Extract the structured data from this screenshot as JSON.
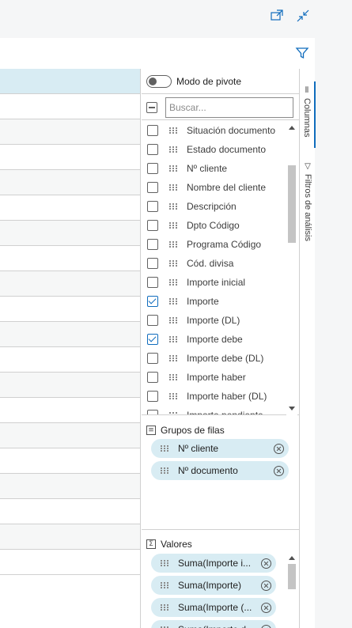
{
  "toolbar": {
    "icons": [
      "open-in-new-window-icon",
      "collapse-icon",
      "filter-icon"
    ]
  },
  "tool_panel": {
    "pivot_mode_label": "Modo de pivote",
    "search_placeholder": "Buscar...",
    "columns": [
      {
        "label": "Situación documento",
        "checked": false
      },
      {
        "label": "Estado documento",
        "checked": false
      },
      {
        "label": "Nº cliente",
        "checked": false
      },
      {
        "label": "Nombre del cliente",
        "checked": false
      },
      {
        "label": "Descripción",
        "checked": false
      },
      {
        "label": "Dpto Código",
        "checked": false
      },
      {
        "label": "Programa Código",
        "checked": false
      },
      {
        "label": "Cód. divisa",
        "checked": false
      },
      {
        "label": "Importe inicial",
        "checked": false
      },
      {
        "label": "Importe",
        "checked": true
      },
      {
        "label": "Importe (DL)",
        "checked": false
      },
      {
        "label": "Importe debe",
        "checked": true
      },
      {
        "label": "Importe debe (DL)",
        "checked": false
      },
      {
        "label": "Importe haber",
        "checked": false
      },
      {
        "label": "Importe haber (DL)",
        "checked": false
      },
      {
        "label": "Importe pendiente",
        "checked": false
      }
    ],
    "row_groups_label": "Grupos de filas",
    "row_groups": [
      "Nº cliente",
      "Nº documento"
    ],
    "values_label": "Valores",
    "values": [
      "Suma(Importe i...",
      "Suma(Importe)",
      "Suma(Importe (...",
      "Suma(Importe d..."
    ]
  },
  "side_tabs": {
    "columns_label": "Columnas",
    "filters_label": "Filtros de análisis"
  },
  "colors": {
    "accent": "#0f6cbd",
    "header_bg": "#d8ecf3",
    "pill_bg": "#d8ecf3"
  }
}
